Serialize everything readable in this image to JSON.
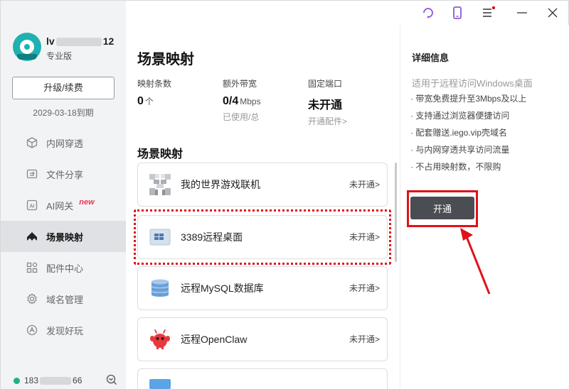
{
  "user": {
    "name_prefix": "lv",
    "name_suffix": "12",
    "plan": "专业版",
    "upgrade_label": "升级/续费",
    "expire": "2029-03-18到期",
    "phone_prefix": "183",
    "phone_suffix": "66"
  },
  "nav": [
    {
      "label": "内网穿透",
      "icon": "cube-icon"
    },
    {
      "label": "文件分享",
      "icon": "share-icon"
    },
    {
      "label": "AI网关",
      "icon": "ai-icon",
      "badge": "new"
    },
    {
      "label": "场景映射",
      "icon": "scene-icon",
      "active": true
    },
    {
      "label": "配件中心",
      "icon": "grid-icon"
    },
    {
      "label": "域名管理",
      "icon": "gear-icon"
    },
    {
      "label": "发现好玩",
      "icon": "discover-icon"
    }
  ],
  "main": {
    "title": "场景映射",
    "stats": [
      {
        "label": "映射条数",
        "value": "0",
        "unit": "个",
        "sub": ""
      },
      {
        "label": "额外带宽",
        "value": "0/4",
        "unit": "Mbps",
        "sub": "已使用/总"
      },
      {
        "label": "固定端口",
        "value": "未开通",
        "unit": "",
        "sub": "开通配件>"
      }
    ],
    "section_title": "场景映射",
    "cards": [
      {
        "name": "我的世界游戏联机",
        "status": "未开通>"
      },
      {
        "name": "3389远程桌面",
        "status": "未开通>"
      },
      {
        "name": "远程MySQL数据库",
        "status": "未开通>"
      },
      {
        "name": "远程OpenClaw",
        "status": "未开通>"
      }
    ]
  },
  "detail": {
    "title": "详细信息",
    "desc": "适用于远程访问Windows桌面",
    "items": [
      "· 带宽免费提升至3Mbps及以上",
      "· 支持通过浏览器便捷访问",
      "· 配套赠送.iego.vip壳域名",
      "· 与内网穿透共享访问流量",
      "· 不占用映射数，不限购"
    ],
    "open_label": "开通"
  },
  "colors": {
    "accent": "#1fb1b1",
    "highlight": "#e0101a",
    "button": "#4a4d52",
    "new_badge": "#e8365d"
  }
}
